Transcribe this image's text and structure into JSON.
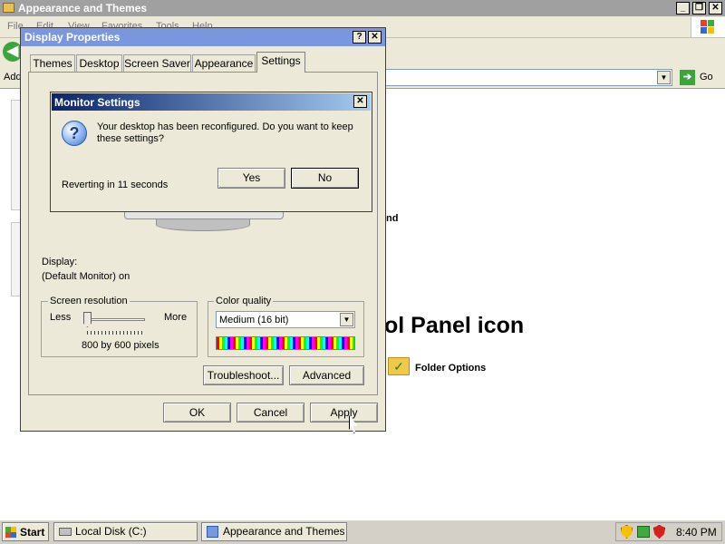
{
  "background_window": {
    "title": "Appearance and Themes",
    "menu": [
      "File",
      "Edit",
      "View",
      "Favorites",
      "Tools",
      "Help"
    ],
    "address_label": "Address",
    "go_label": "Go",
    "panel_heading_fragment": "ol Panel icon",
    "fragment_nd": "nd",
    "folder_options_label": "Folder Options"
  },
  "display_properties": {
    "title": "Display Properties",
    "tabs": [
      "Themes",
      "Desktop",
      "Screen Saver",
      "Appearance",
      "Settings"
    ],
    "active_tab": "Settings",
    "display_label": "Display:",
    "display_value": "(Default Monitor) on",
    "screen_resolution": {
      "title": "Screen resolution",
      "less": "Less",
      "more": "More",
      "value": "800 by 600 pixels"
    },
    "color_quality": {
      "title": "Color quality",
      "selected": "Medium (16 bit)"
    },
    "troubleshoot_label": "Troubleshoot...",
    "advanced_label": "Advanced",
    "ok_label": "OK",
    "cancel_label": "Cancel",
    "apply_label": "Apply"
  },
  "monitor_dialog": {
    "title": "Monitor Settings",
    "message": "Your desktop has been reconfigured.  Do you want to keep these settings?",
    "countdown": "Reverting in 11 seconds",
    "yes_label": "Yes",
    "no_label": "No"
  },
  "taskbar": {
    "start_label": "Start",
    "items": [
      "Local Disk (C:)",
      "Appearance and Themes"
    ],
    "clock": "8:40 PM"
  },
  "colors": {
    "title_active": "#0a246a",
    "title_inactive": "#7a96df",
    "face": "#ece9d8",
    "taskbar": "#d4d0c8"
  }
}
